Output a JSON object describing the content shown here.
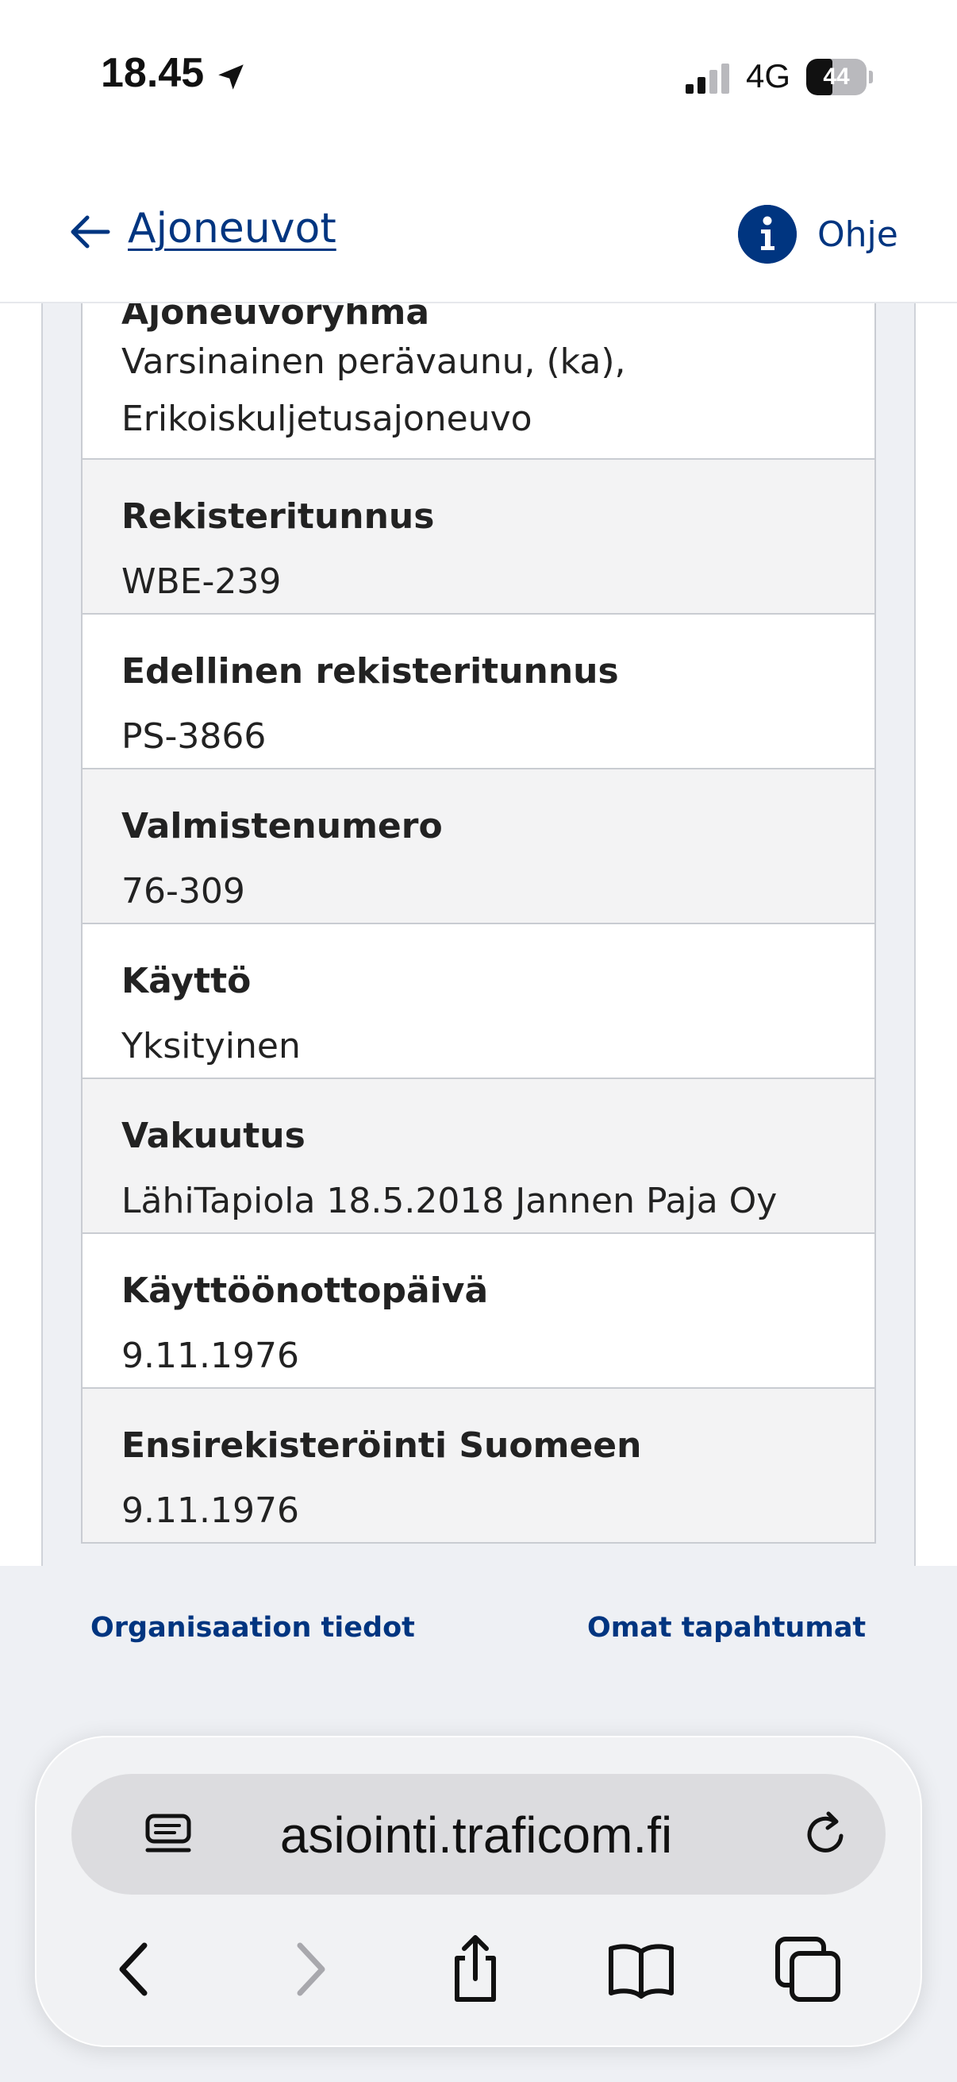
{
  "status_bar": {
    "time": "18.45",
    "network": "4G",
    "battery_level": 44,
    "battery_text": "44"
  },
  "header": {
    "back_label": "Ajoneuvot",
    "help_label": "Ohje",
    "accent_color": "#003580"
  },
  "details": [
    {
      "label": "Ajoneuvoryhmä",
      "value": "Varsinainen perävaunu, (ka), Erikoiskuljetusajoneuvo"
    },
    {
      "label": "Rekisteritunnus",
      "value": "WBE-239"
    },
    {
      "label": "Edellinen rekisteritunnus",
      "value": "PS-3866"
    },
    {
      "label": "Valmistenumero",
      "value": "76-309"
    },
    {
      "label": "Käyttö",
      "value": "Yksityinen"
    },
    {
      "label": "Vakuutus",
      "value": "LähiTapiola 18.5.2018 Jannen Paja Oy"
    },
    {
      "label": "Käyttöönottopäivä",
      "value": "9.11.1976"
    },
    {
      "label": "Ensirekisteröinti Suomeen",
      "value": "9.11.1976"
    }
  ],
  "footer": {
    "link_org": "Organisaation tiedot",
    "link_events": "Omat tapahtumat"
  },
  "browser": {
    "url": "asiointi.traficom.fi",
    "toolbar_icons": [
      "back-icon",
      "forward-icon",
      "share-icon",
      "bookmarks-icon",
      "tabs-icon"
    ]
  }
}
